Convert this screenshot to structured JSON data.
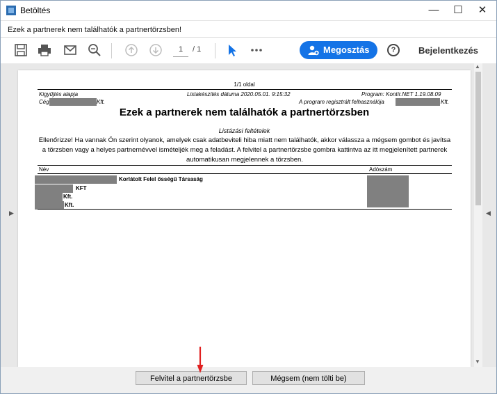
{
  "window": {
    "title": "Betöltés",
    "minimize": "—",
    "maximize": "☐",
    "close": "✕"
  },
  "subheader": "Ezek a partnerek nem találhatók a partnertörzsben!",
  "toolbar": {
    "page_current": "1",
    "page_total": "/ 1",
    "share_label": "Megosztás",
    "help_glyph": "?",
    "signin_label": "Bejelentkezés"
  },
  "doc": {
    "page_number": "1/1 oldal",
    "meta_left": "Kigyűjtés alapja",
    "meta_center": "Listakészítés dátuma 2020.05.01. 9:15:32",
    "meta_right": "Program: Kontír.NET 1.19.08.09",
    "meta_company_prefix": "Cég",
    "meta_company_suffix": "Kft.",
    "meta_user": "A program regisztrált felhasználója",
    "meta_user_suffix": "Kft.",
    "title": "Ezek a partnerek nem találhatók a partnertörzsben",
    "criteria": "Listázási feltételek",
    "body": "Ellenőrizze! Ha vannak Ön szerint olyanok, amelyek csak adatbeviteli hiba miatt nem találhatók, akkor válassza a mégsem gombot és javítsa a törzsben vagy a helyes partnernévvel ismételjék meg a feladást. A felvitel a partnertörzsbe gombra kattintva az itt megjelenített partnerek automatikusan megjelennek a törzsben.",
    "col_name": "Név",
    "col_tax": "Adószám",
    "rows": [
      "Korlátolt Felel ősségű Társaság",
      "KFT",
      "Kft.",
      "Kft."
    ]
  },
  "buttons": {
    "import": "Felvitel a partnertörzsbe",
    "cancel": "Mégsem (nem tölti be)"
  },
  "colors": {
    "accent": "#1473e6",
    "arrow": "#e02020",
    "redact": "#808080"
  }
}
